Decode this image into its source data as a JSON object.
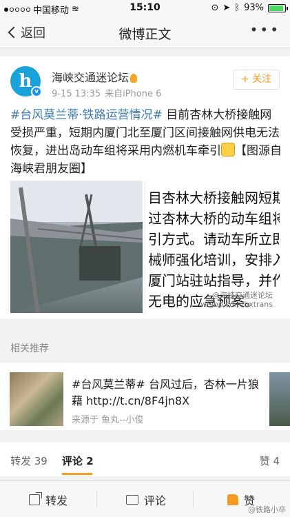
{
  "status_bar": {
    "carrier": "中国移动",
    "time": "15:10",
    "battery": "93%"
  },
  "nav": {
    "back_label": "返回",
    "title": "微博正文",
    "more": "•••"
  },
  "post": {
    "author": "海峡交通迷论坛",
    "time": "9-15 13:35",
    "source": "来自iPhone 6",
    "follow_label": "+ 关注",
    "hashtag": "#台风莫兰蒂·铁路运营情况#",
    "text": " 目前杏林大桥接触网受损严重，短期内厦门北至厦门区间接触网供电无法恢复，进出岛动车组将采用内燃机车牵引",
    "text_tail": "【图源自海峡君朋友圈】",
    "image2_lines": [
      "目杏林大桥接触网短期不",
      "过杏林大桥的动车组将",
      "引方式。请动车所立即",
      "械师强化培训，安排入",
      "厦门站驻站指导，并作",
      "无电的应急预案。"
    ],
    "image2_watermark_1": "@海峡交通迷论坛",
    "image2_watermark_2": "weibo.com/hxtrans"
  },
  "related": {
    "header": "相关推荐",
    "hashtag": "#台风莫兰蒂#",
    "text": " 台风过后，杏林一片狼藉 http://t.cn/8F4jn8X",
    "source": "来源于 鱼丸--小俊"
  },
  "tabs": {
    "repost": "转发 39",
    "comment": "评论 2",
    "like": "赞 4"
  },
  "bottom_bar": {
    "repost": "转发",
    "comment": "评论",
    "like": "赞",
    "watermark": "@铁路小卒"
  }
}
